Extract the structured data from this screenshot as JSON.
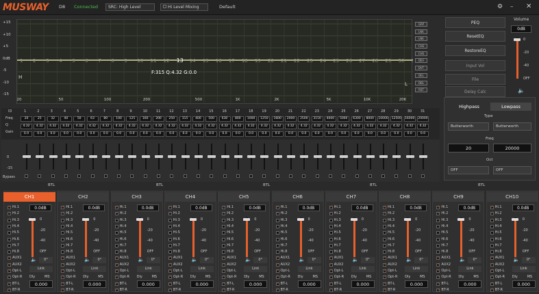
{
  "app": {
    "logo": "MUSWAY",
    "model": "D8",
    "status": "Connected",
    "src_label": "SRC:",
    "src_value": "High Level",
    "hl_mixing": "Hi Level Mixing",
    "preset": "Default"
  },
  "colors": {
    "accent": "#e8602c",
    "status": "#47c24a"
  },
  "eq": {
    "y_labels": [
      "+15",
      "+10",
      "+5",
      "0dB",
      "-5",
      "-10",
      "-15"
    ],
    "x_labels": [
      "20",
      "50",
      "100",
      "200",
      "500",
      "1K",
      "2K",
      "5K",
      "10K",
      "20K"
    ],
    "bands": [
      "1",
      "2",
      "3",
      "4",
      "5",
      "6",
      "7",
      "8",
      "9",
      "10",
      "11",
      "12",
      "13",
      "14",
      "15",
      "16",
      "17",
      "18",
      "19",
      "20",
      "21",
      "22",
      "23",
      "24",
      "25",
      "26",
      "27",
      "28",
      "29",
      "30",
      "31"
    ],
    "active_band": "13",
    "readout": "F:315 Q:4.32 G:0.0",
    "h_marker": "H",
    "l_marker": "L",
    "side_buttons": [
      "GRP",
      "LNK",
      "LNK",
      "CHS",
      "CHS",
      "DEV",
      "DVT",
      "DEL",
      "DBL",
      "RST"
    ]
  },
  "right": {
    "buttons": [
      "PEQ",
      "ResetEQ",
      "RestoreEQ",
      "Input Vol",
      "File",
      "Delay Calc"
    ],
    "volume_label": "Volume",
    "volume_value": "0dB",
    "volume_ticks": [
      "0",
      "-20",
      "-40",
      "OFF"
    ],
    "mute_icon": "speaker-icon"
  },
  "filter": {
    "tabs": [
      "Highpass",
      "Lowpass"
    ],
    "type_label": "Type",
    "hp_type": "Butterworth",
    "lp_type": "Butterworth",
    "freq_label": "Freq",
    "hp_freq": "20",
    "lp_freq": "20000",
    "oct_label": "Oct",
    "hp_oct": "OFF",
    "lp_oct": "OFF"
  },
  "table": {
    "header_label": "ID",
    "rows": [
      "Freq",
      "Q",
      "Gain"
    ],
    "freqs": [
      "20",
      "25",
      "32",
      "40",
      "50",
      "63",
      "80",
      "100",
      "125",
      "160",
      "200",
      "250",
      "315",
      "400",
      "500",
      "630",
      "800",
      "1000",
      "1250",
      "1600",
      "2000",
      "2500",
      "3150",
      "4000",
      "5000",
      "6300",
      "8000",
      "10000",
      "12500",
      "16000",
      "20000"
    ],
    "q": "4.32",
    "gain": "0.0",
    "fader_ticks": [
      "0",
      "-15"
    ],
    "bypass": "Bypass"
  },
  "channels": {
    "names": [
      "CH1",
      "CH2",
      "CH3",
      "CH4",
      "CH5",
      "CH6",
      "CH7",
      "CH8",
      "CH9",
      "CH10"
    ],
    "btl": "BTL",
    "vol": "0.0dB",
    "inputs": [
      "Hi.1",
      "Hi.2",
      "Hi.3",
      "Hi.4",
      "Hi.5",
      "Hi.6",
      "Hi.7",
      "Hi.8",
      "AUX1",
      "AUX2",
      "Opt-L",
      "Opt-R",
      "BT-L",
      "BT-R"
    ],
    "ticks": [
      "0",
      "-20",
      "-40",
      "OFF"
    ],
    "phase": "0°",
    "link": "Link",
    "dly": "Dly",
    "ms": "MS",
    "delay": "0.000"
  }
}
